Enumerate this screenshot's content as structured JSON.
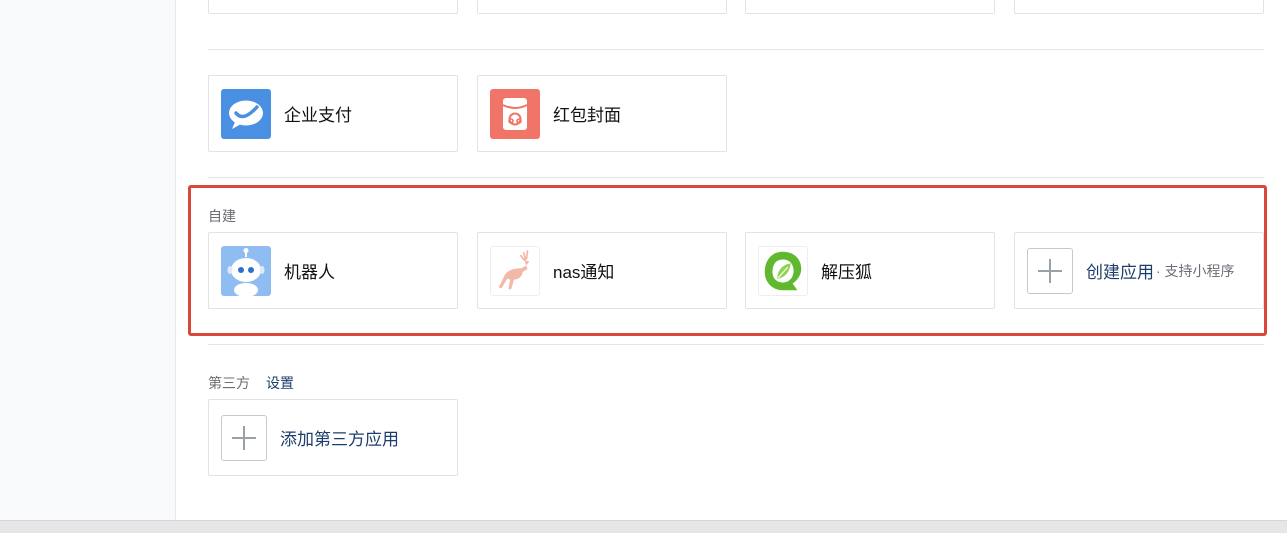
{
  "colors": {
    "accent_link": "#1d3e6a",
    "highlight_border": "#d9463c",
    "pay_icon_bg": "#4a90e2",
    "redpacket_icon_bg": "#f07468"
  },
  "enterprise_apps": [
    {
      "label": "企业支付",
      "icon": "wechat-pay-icon"
    },
    {
      "label": "红包封面",
      "icon": "red-packet-icon"
    }
  ],
  "self_built": {
    "section_label": "自建",
    "apps": [
      {
        "label": "机器人",
        "icon": "robot-icon"
      },
      {
        "label": "nas通知",
        "icon": "deer-icon"
      },
      {
        "label": "解压狐",
        "icon": "leaf-logo-icon"
      }
    ],
    "create": {
      "label": "创建应用",
      "sub": "· 支持小程序",
      "icon": "plus-icon"
    }
  },
  "third_party": {
    "section_label": "第三方",
    "settings_link": "设置",
    "add": {
      "label": "添加第三方应用",
      "icon": "plus-icon"
    }
  }
}
